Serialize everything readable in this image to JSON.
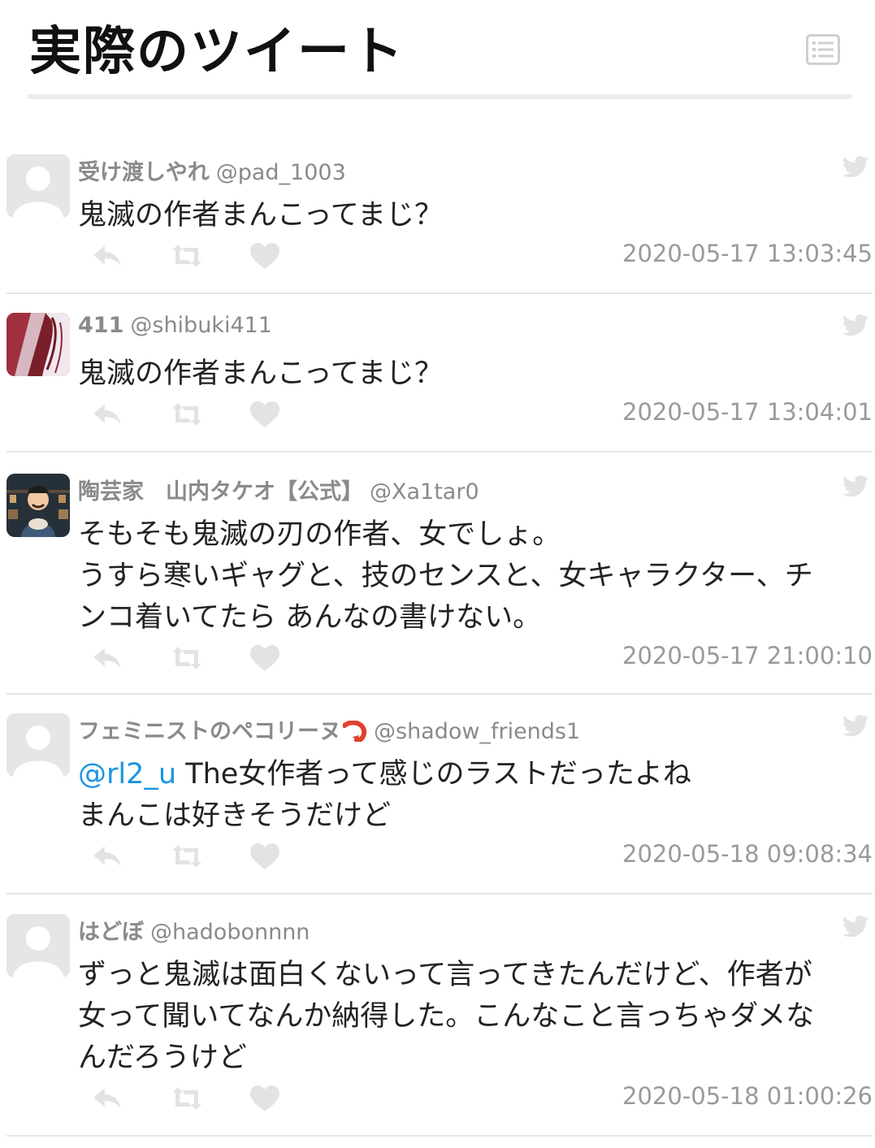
{
  "page": {
    "title": "実際のツイート",
    "menu_icon": "list-icon"
  },
  "colors": {
    "mention": "#1b95e0",
    "meta_text": "#8a8a8a",
    "icon_gray": "#e3e3e3",
    "divider": "#e6e6e6"
  },
  "tweets": [
    {
      "name": "受け渡しやれ",
      "handle": "@pad_1003",
      "avatar": "default-avatar",
      "body": [
        {
          "mention": "",
          "text": "鬼滅の作者まんこってまじ？"
        }
      ],
      "timestamp": "2020-05-17 13:03:45"
    },
    {
      "name": "411",
      "handle": "@shibuki411",
      "avatar": "anime-avatar",
      "body": [
        {
          "mention": "",
          "text": "鬼滅の作者まんこってまじ？"
        }
      ],
      "timestamp": "2020-05-17 13:04:01"
    },
    {
      "name": "陶芸家　山内タケオ【公式】",
      "handle": "@Xa1tar0",
      "avatar": "potter-avatar",
      "body": [
        {
          "mention": "",
          "text": "そもそも鬼滅の刃の作者、女でしょ。"
        },
        {
          "mention": "",
          "text": "うすら寒いギャグと、技のセンスと、女キャラクター、チ"
        },
        {
          "mention": "",
          "text": "ンコ着いてたら あんなの書けない。"
        }
      ],
      "timestamp": "2020-05-17 21:00:10"
    },
    {
      "name": "フェミニストのペコリーヌ",
      "handle": "@shadow_friends1",
      "avatar": "default-avatar",
      "body": [
        {
          "mention": "@rl2_u",
          "text": " The女作者って感じのラストだったよね"
        },
        {
          "mention": "",
          "text": "まんこは好きそうだけど"
        }
      ],
      "timestamp": "2020-05-18 09:08:34"
    },
    {
      "name": "はどぼ",
      "handle": "@hadobonnnn",
      "avatar": "default-avatar",
      "body": [
        {
          "mention": "",
          "text": "ずっと鬼滅は面白くないって言ってきたんだけど、作者が"
        },
        {
          "mention": "",
          "text": "女って聞いてなんか納得した。こんなこと言っちゃダメな"
        },
        {
          "mention": "",
          "text": "んだろうけど"
        }
      ],
      "timestamp": "2020-05-18 01:00:26"
    }
  ]
}
